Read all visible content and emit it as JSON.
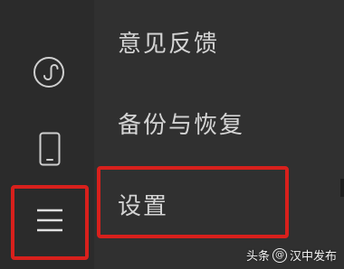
{
  "sidebar": {
    "icons": [
      {
        "name": "mini-program-icon"
      },
      {
        "name": "phone-icon"
      },
      {
        "name": "menu-icon"
      }
    ]
  },
  "menu": {
    "items": [
      {
        "label": "意见反馈"
      },
      {
        "label": "备份与恢复"
      },
      {
        "label": "设置"
      }
    ]
  },
  "watermark": {
    "prefix": "头条",
    "at": "@",
    "name": "汉中发布"
  },
  "colors": {
    "background": "#2e2e2e",
    "text": "#d4d4d4",
    "highlight": "#d8201c"
  }
}
